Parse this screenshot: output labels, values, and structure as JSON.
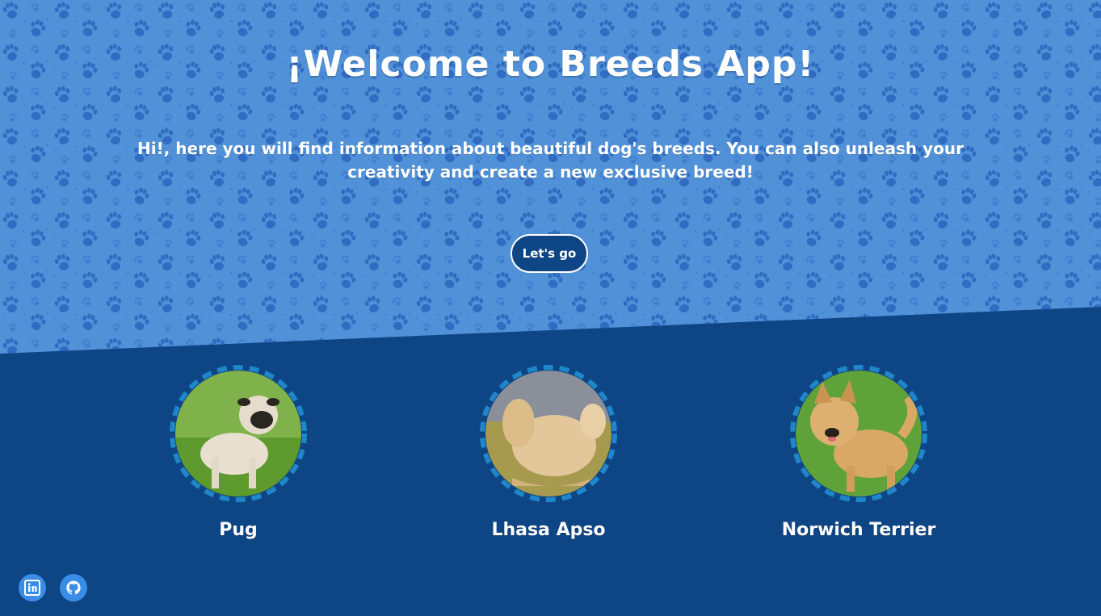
{
  "hero": {
    "title": "¡Welcome to Breeds App!",
    "intro": "Hi!, here you will find information about beautiful dog's breeds. You can also unleash your creativity and create a new exclusive breed!",
    "cta_label": "Let's go"
  },
  "breeds": [
    {
      "name": "Pug"
    },
    {
      "name": "Lhasa Apso"
    },
    {
      "name": "Norwich Terrier"
    }
  ],
  "social": [
    {
      "icon": "linkedin-icon"
    },
    {
      "icon": "github-icon"
    }
  ],
  "colors": {
    "hero_bg": "#5191d8",
    "paw": "#2f6cc2",
    "page_bg": "#0e4585",
    "ring": "#1f86c9",
    "social_bg": "#3a8de6"
  }
}
